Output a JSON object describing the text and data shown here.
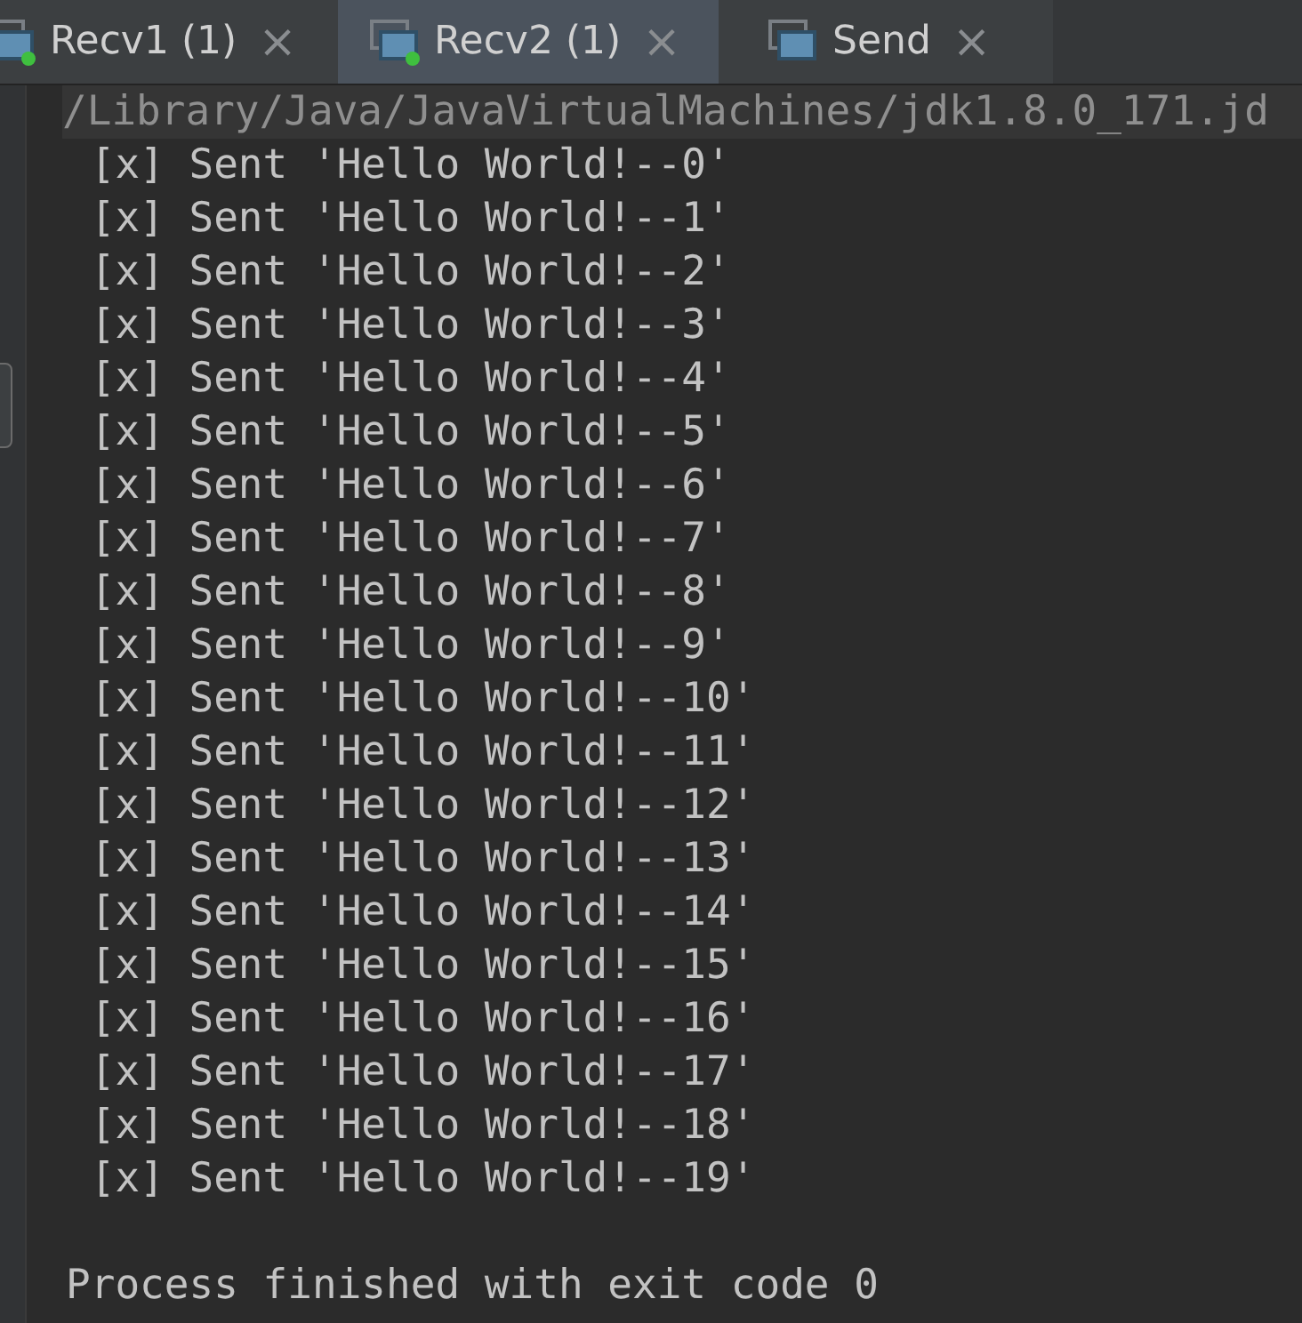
{
  "tabs": [
    {
      "label": "Recv1 (1)",
      "selected": false,
      "running": true,
      "close": "×"
    },
    {
      "label": "Recv2 (1)",
      "selected": true,
      "running": true,
      "close": "×"
    },
    {
      "label": "Send",
      "selected": false,
      "running": false,
      "close": "×"
    }
  ],
  "console": {
    "command": "/Library/Java/JavaVirtualMachines/jdk1.8.0_171.jd",
    "lines": [
      " [x] Sent 'Hello World!--0'",
      " [x] Sent 'Hello World!--1'",
      " [x] Sent 'Hello World!--2'",
      " [x] Sent 'Hello World!--3'",
      " [x] Sent 'Hello World!--4'",
      " [x] Sent 'Hello World!--5'",
      " [x] Sent 'Hello World!--6'",
      " [x] Sent 'Hello World!--7'",
      " [x] Sent 'Hello World!--8'",
      " [x] Sent 'Hello World!--9'",
      " [x] Sent 'Hello World!--10'",
      " [x] Sent 'Hello World!--11'",
      " [x] Sent 'Hello World!--12'",
      " [x] Sent 'Hello World!--13'",
      " [x] Sent 'Hello World!--14'",
      " [x] Sent 'Hello World!--15'",
      " [x] Sent 'Hello World!--16'",
      " [x] Sent 'Hello World!--17'",
      " [x] Sent 'Hello World!--18'",
      " [x] Sent 'Hello World!--19'"
    ],
    "exit_message": "Process finished with exit code 0"
  }
}
